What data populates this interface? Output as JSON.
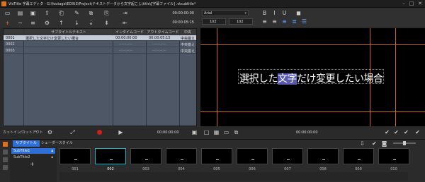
{
  "window": {
    "title": "VisTitle 字幕エディタ - G:\\footage\\EDIUS\\Project\\テキストデータから文字起こし\\title\\[字幕ファイル] .vtsubtitle*",
    "min": "–",
    "max": "□",
    "close": "✕"
  },
  "toolbar": {
    "time_in": "00:00:00:00",
    "time_out": "00:00:05:15"
  },
  "table": {
    "headers": [
      "",
      "サブタイトルテキスト",
      "インタイムコード",
      "アウトタイムコード",
      "中央"
    ],
    "rows": [
      {
        "id": "0001",
        "text": "選択した文字だけ変更したい場合",
        "in": "00:00:00:00",
        "out": "00:00:05:15",
        "pos": "中央揃え"
      },
      {
        "id": "0002",
        "text": "",
        "in": "--:--:--:--",
        "out": "--:--:--:--",
        "pos": "中央揃え"
      },
      {
        "id": "0003",
        "text": "",
        "in": "--:--:--:--",
        "out": "--:--:--:--",
        "pos": "中央揃え"
      }
    ]
  },
  "leftbar": {
    "mode_label": "カットイン/カットアウト",
    "time": "00:00:00:00"
  },
  "font": {
    "name": "Arial",
    "size_a": "102",
    "size_b": "102"
  },
  "preview": {
    "caption_before": "選択した",
    "caption_highlight": "文字",
    "caption_after": "だけ変更したい場合"
  },
  "rightbar": {
    "time": "00:00:00:00"
  },
  "tabs": {
    "style_tab": "サブタイトル",
    "shader_tab": "シェーダースタイル"
  },
  "styles": [
    {
      "label": "SubTitle1"
    },
    {
      "label": "SubTitle2"
    }
  ],
  "add_label": "+",
  "thumbnails": [
    "001",
    "002",
    "003",
    "004",
    "005",
    "006",
    "007",
    "008",
    "009",
    "010"
  ],
  "colors": {
    "accent": "#e07020",
    "selection": "#2d6fd6",
    "table_bg": "#4d5766",
    "guide": "#c86a1e"
  }
}
